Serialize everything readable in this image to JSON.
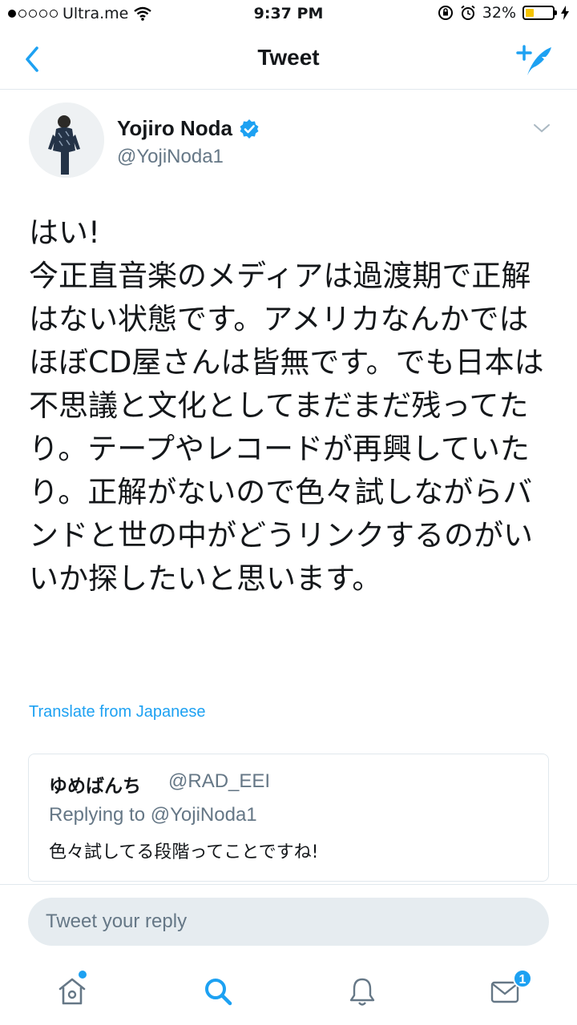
{
  "status_bar": {
    "carrier": "Ultra.me",
    "time": "9:37 PM",
    "battery_percent": "32%",
    "battery_level": 0.32,
    "battery_color": "#f5c400"
  },
  "nav": {
    "title": "Tweet",
    "back_icon": "chevron-left-icon",
    "compose_icon": "compose-tweet-icon"
  },
  "tweet": {
    "author_name": "Yojiro Noda",
    "verified": true,
    "author_handle": "@YojiNoda1",
    "text": "はい!\n今正直音楽のメディアは過渡期で正解はない状態です。アメリカなんかではほぼCD屋さんは皆無です。でも日本は不思議と文化としてまだまだ残ってたり。テープやレコードが再興していたり。正解がないので色々試しながらバンドと世の中がどうリンクするのがいいか探したいと思います。",
    "translate_label": "Translate from Japanese"
  },
  "quoted_reply": {
    "name": "ゆめばんち",
    "handle": "@RAD_EEI",
    "replying_to": "Replying to @YojiNoda1",
    "text": "色々試してる段階ってことですね!"
  },
  "reply_box": {
    "placeholder": "Tweet your reply"
  },
  "tab_bar": {
    "items": [
      "home-icon",
      "search-icon",
      "notifications-icon",
      "messages-icon"
    ],
    "messages_badge": "1",
    "accent_color": "#1da1f2"
  }
}
